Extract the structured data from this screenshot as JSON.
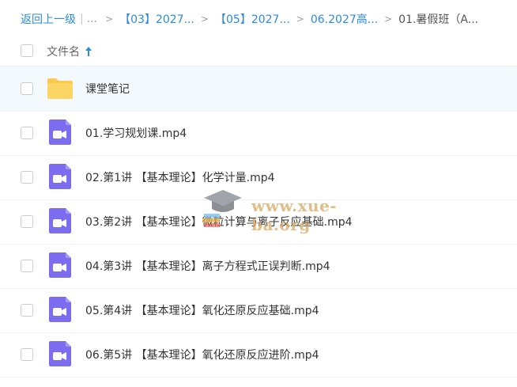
{
  "breadcrumb": {
    "back": "返回上一级",
    "ellipsis": "...",
    "items": [
      "【03】2027...",
      "【05】2027...",
      "06.2027高..."
    ],
    "current": "01.暑假班（A..."
  },
  "header": {
    "name_col": "文件名"
  },
  "rows": [
    {
      "name": "课堂笔记",
      "type": "folder"
    },
    {
      "name": "01.学习规划课.mp4",
      "type": "video"
    },
    {
      "name": "02.第1讲 【基本理论】化学计量.mp4",
      "type": "video"
    },
    {
      "name": "03.第2讲 【基本理论】微粒计算与离子反应基础.mp4",
      "type": "video"
    },
    {
      "name": "04.第3讲 【基本理论】离子方程式正误判断.mp4",
      "type": "video"
    },
    {
      "name": "05.第4讲 【基本理论】氧化还原反应基础.mp4",
      "type": "video"
    },
    {
      "name": "06.第5讲 【基本理论】氧化还原反应进阶.mp4",
      "type": "video"
    }
  ],
  "watermark": {
    "text": "www.xue-ba.org"
  },
  "colors": {
    "accent": "#2b8cde",
    "folder": "#fcc94b",
    "video": "#7b6cf0",
    "highlight": "#f3f9fd"
  }
}
